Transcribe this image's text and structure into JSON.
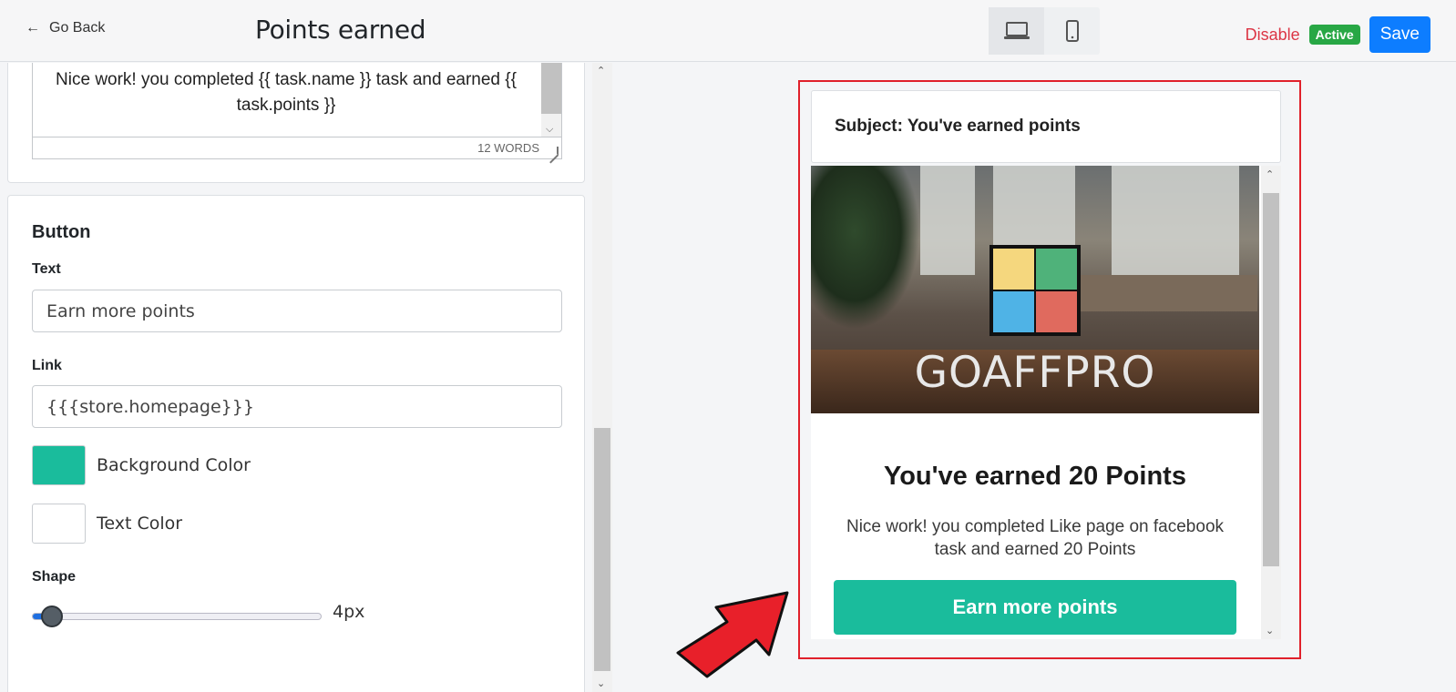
{
  "header": {
    "go_back_label": "Go Back",
    "title": "Points earned",
    "devices": [
      {
        "name": "desktop-icon",
        "active": true
      },
      {
        "name": "mobile-icon",
        "active": false
      }
    ],
    "disable_label": "Disable",
    "status_badge": "Active",
    "save_label": "Save"
  },
  "editor": {
    "content": "Nice work! you completed {{ task.name }} task and earned {{ task.points }}",
    "word_count": "12 WORDS"
  },
  "button_settings": {
    "section_title": "Button",
    "text_label": "Text",
    "text_value": "Earn more points",
    "link_label": "Link",
    "link_value": "{{{store.homepage}}}",
    "background_color_label": "Background Color",
    "background_color": "#1abc9c",
    "text_color_label": "Text Color",
    "text_color": "#ffffff",
    "shape_label": "Shape",
    "shape_value": "4px",
    "shape_level": 0.07
  },
  "preview": {
    "subject": "Subject: You've earned points",
    "brand": "GOAFFPRO",
    "heading": "You've earned 20 Points",
    "message": "Nice work! you completed Like page on facebook task and earned 20 Points",
    "cta_label": "Earn more points",
    "highlight_color": "#e0202b"
  },
  "colors": {
    "accent": "#0d7dff",
    "danger": "#dc3545",
    "success": "#28a745",
    "cta": "#1abc9c"
  }
}
